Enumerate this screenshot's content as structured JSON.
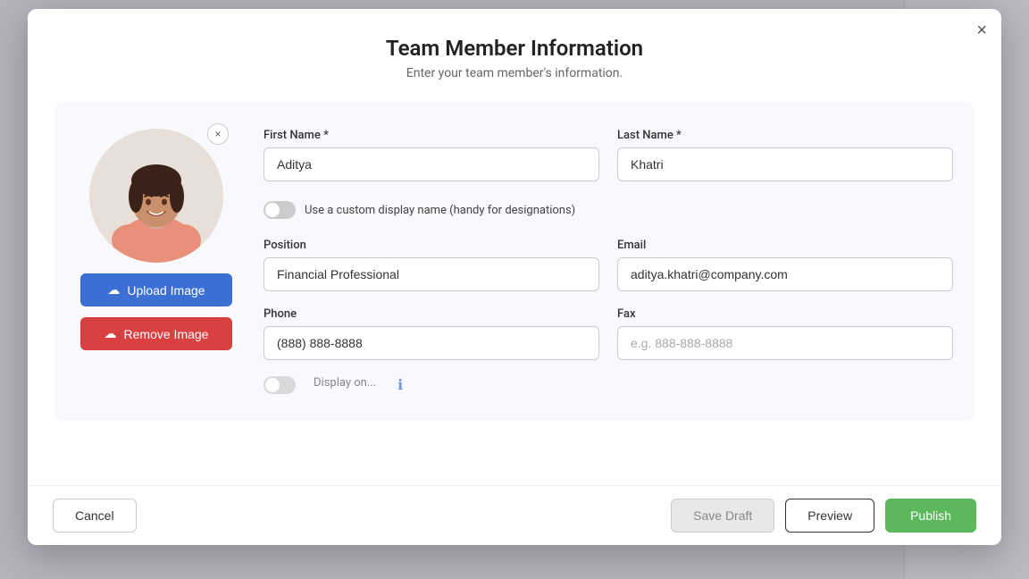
{
  "modal": {
    "title": "Team Member Information",
    "subtitle": "Enter your team member's information.",
    "close_label": "×"
  },
  "avatar": {
    "close_label": "×",
    "alt": "Team member photo"
  },
  "buttons": {
    "upload_image": "Upload Image",
    "remove_image": "Remove Image",
    "cancel": "Cancel",
    "save_draft": "Save Draft",
    "preview": "Preview",
    "publish": "Publish"
  },
  "form": {
    "first_name_label": "First Name *",
    "first_name_value": "Aditya",
    "last_name_label": "Last Name *",
    "last_name_value": "Khatri",
    "toggle_label": "Use a custom display name (handy for designations)",
    "position_label": "Position",
    "position_value": "Financial Professional",
    "email_label": "Email",
    "email_value": "aditya.khatri@company.com",
    "phone_label": "Phone",
    "phone_value": "(888) 888-8888",
    "fax_label": "Fax",
    "fax_placeholder": "e.g. 888-888-8888"
  }
}
